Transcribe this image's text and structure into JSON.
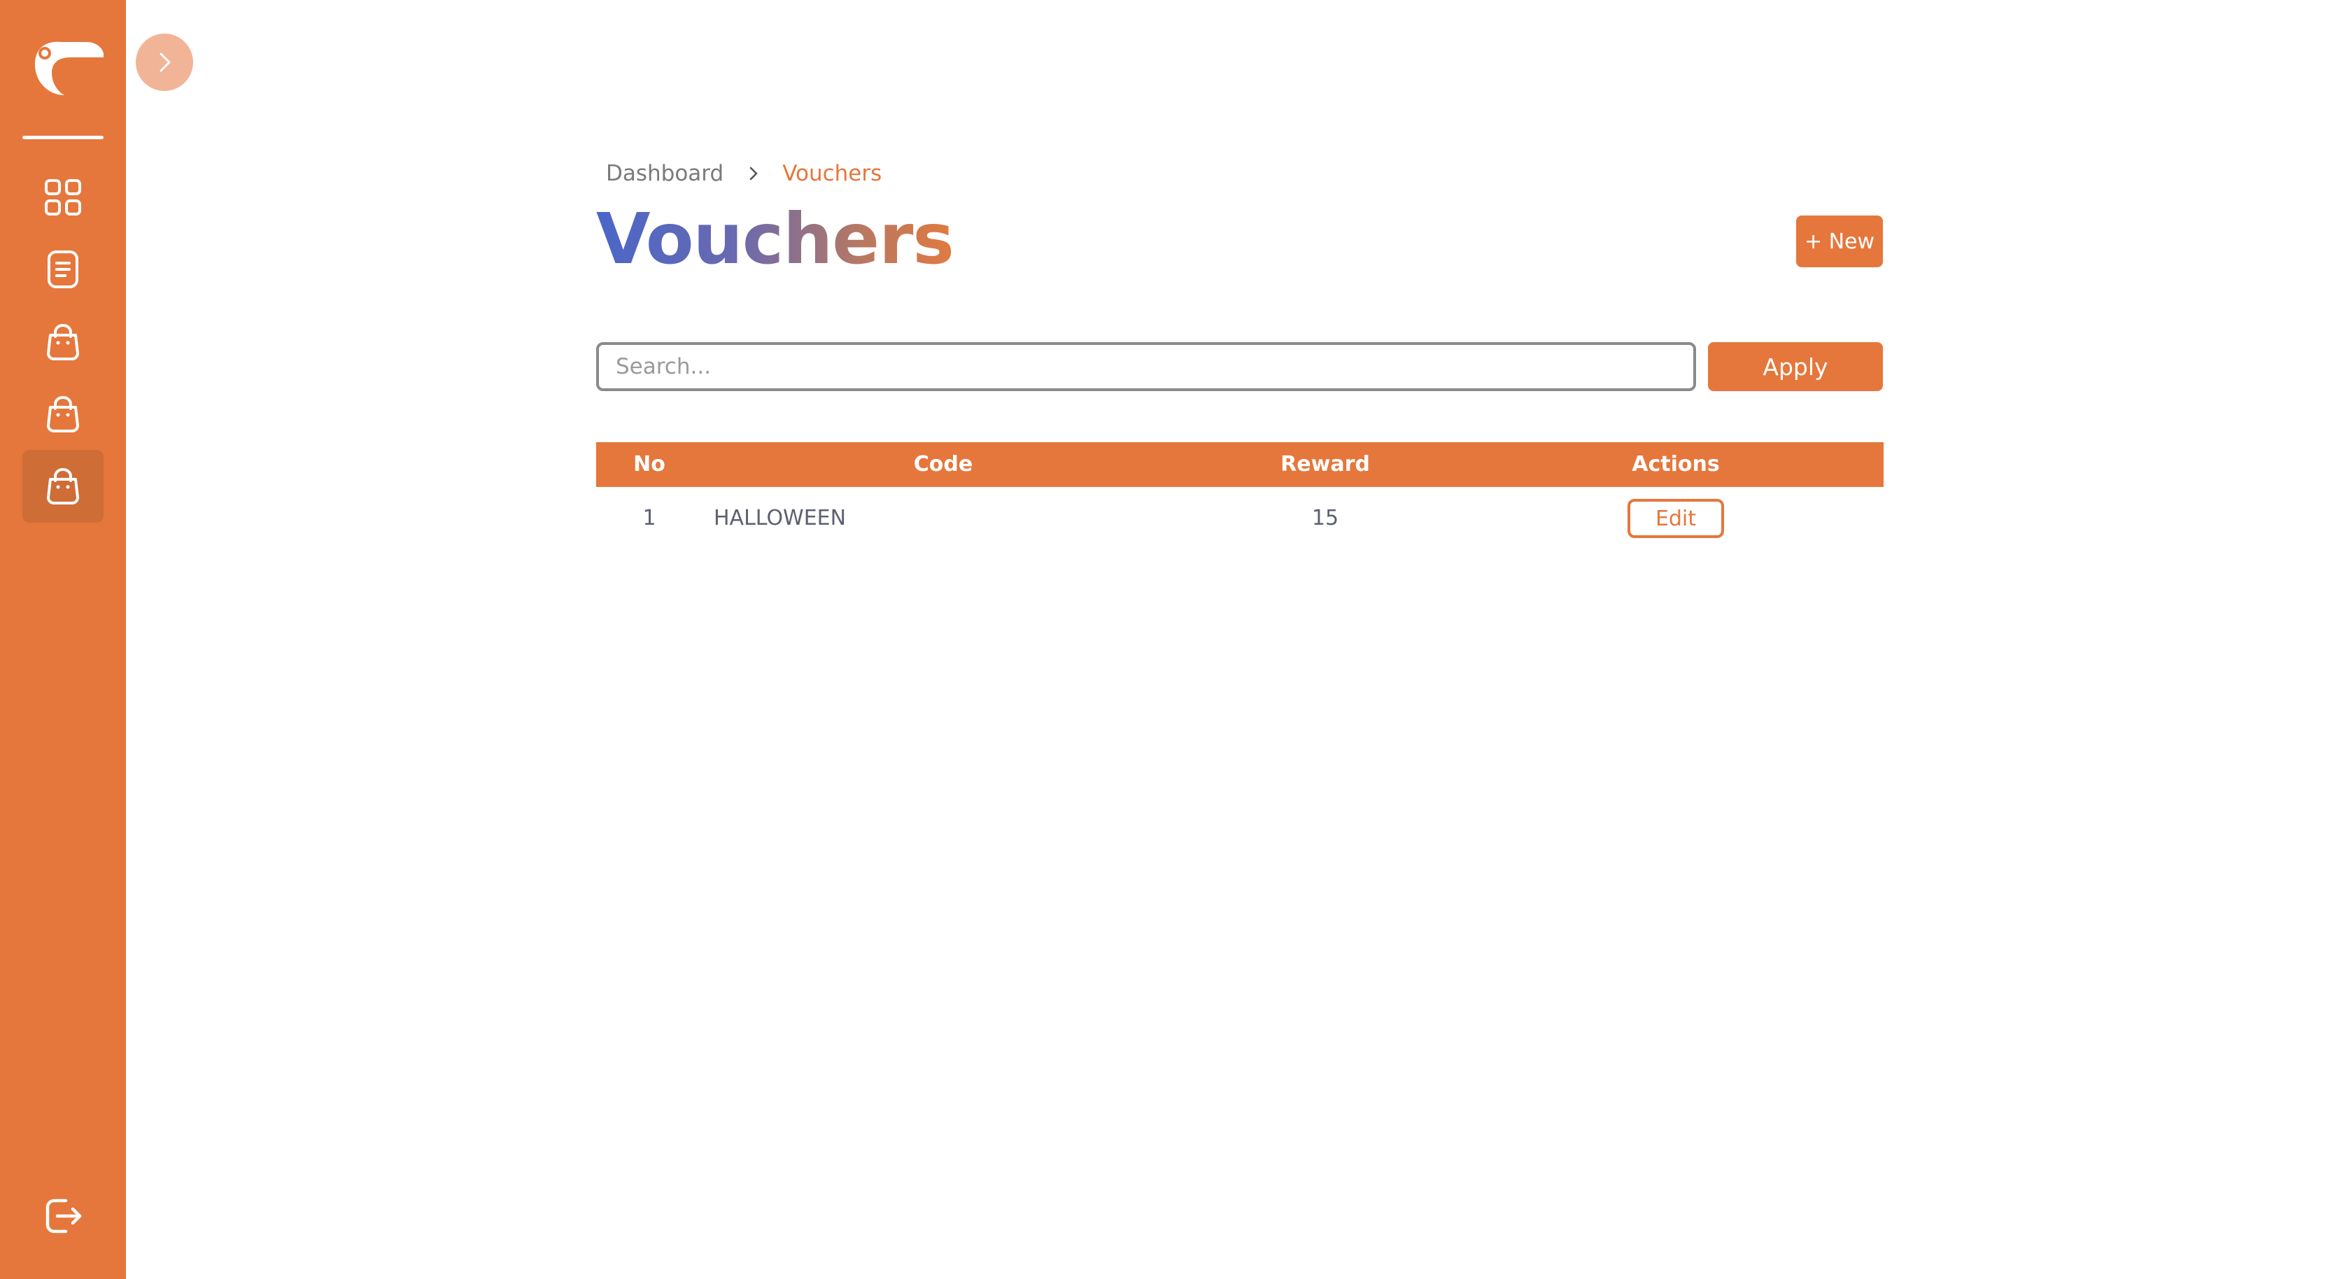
{
  "sidebar": {
    "logo": "toucan-logo",
    "items": [
      {
        "icon": "grid-icon",
        "active": false
      },
      {
        "icon": "document-icon",
        "active": false
      },
      {
        "icon": "shopping-bag-icon",
        "active": false
      },
      {
        "icon": "shopping-bag-icon",
        "active": false
      },
      {
        "icon": "shopping-bag-icon",
        "active": true
      }
    ],
    "logout_icon": "logout-icon"
  },
  "toggle_icon": "chevron-right-icon",
  "breadcrumb": {
    "items": [
      "Dashboard",
      "Vouchers"
    ]
  },
  "page": {
    "title": "Vouchers",
    "new_button": "+ New"
  },
  "search": {
    "placeholder": "Search...",
    "value": "",
    "apply_label": "Apply"
  },
  "table": {
    "headers": [
      "No",
      "Code",
      "Reward",
      "Actions"
    ],
    "rows": [
      {
        "no": "1",
        "code": "HALLOWEEN",
        "reward": "15",
        "action": "Edit"
      }
    ]
  },
  "colors": {
    "accent": "#E5773C",
    "active_nav": "#CF6D37",
    "title_gradient_start": "#4A66C9",
    "title_gradient_end": "#E17A3F"
  }
}
